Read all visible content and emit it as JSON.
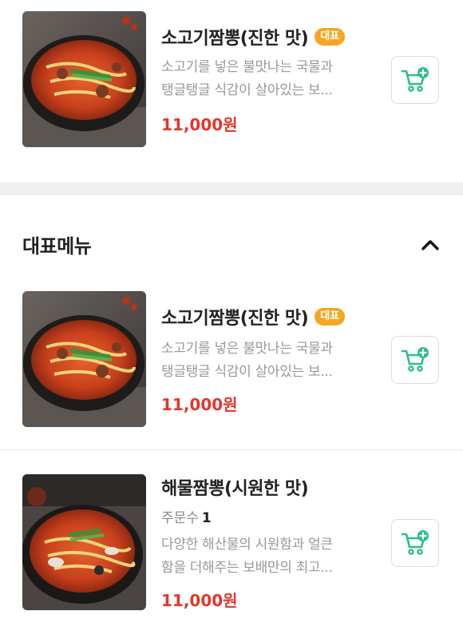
{
  "top_item": {
    "name": "소고기짬뽕(진한 맛)",
    "badge": "대표",
    "desc_line1": "소고기를 넣은 불맛나는 국물과",
    "desc_line2": "탱글탱글 식감이 살아있는 보...",
    "price": "11,000원",
    "image_icon": "beef-jjamppong-photo",
    "cart_icon": "cart-add-icon"
  },
  "section": {
    "title": "대표메뉴",
    "toggle_icon": "chevron-up-icon"
  },
  "items": [
    {
      "name": "소고기짬뽕(진한 맛)",
      "badge": "대표",
      "desc_line1": "소고기를 넣은 불맛나는 국물과",
      "desc_line2": "탱글탱글 식감이 살아있는 보...",
      "price": "11,000원",
      "image_icon": "beef-jjamppong-photo",
      "cart_icon": "cart-add-icon"
    },
    {
      "name": "해물짬뽕(시원한 맛)",
      "order_label": "주문수",
      "order_count": "1",
      "desc_line1": "다양한 해산물의 시원함과 얼큰",
      "desc_line2": "함을 더해주는 보배만의 최고...",
      "price": "11,000원",
      "image_icon": "seafood-jjamppong-photo",
      "cart_icon": "cart-add-icon"
    }
  ],
  "colors": {
    "price": "#e1382c",
    "badge": "#f6a623",
    "cart_accent": "#2dbf8a",
    "section_gap": "#f0f0f2"
  }
}
